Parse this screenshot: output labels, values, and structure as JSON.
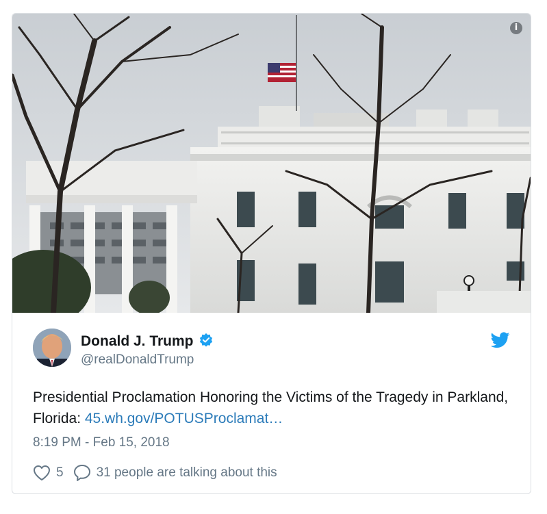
{
  "media": {
    "alt_icon": "info-icon",
    "info_glyph": "i"
  },
  "author": {
    "name": "Donald J. Trump",
    "handle": "@realDonaldTrump",
    "verified_icon": "verified-badge-icon",
    "platform_icon": "twitter-bird-icon"
  },
  "tweet": {
    "text": "Presidential Proclamation Honoring the Victims of the Tragedy in Parkland, Florida: ",
    "link": "45.wh.gov/POTUSProclamat…",
    "timestamp": "8:19 PM - Feb 15, 2018"
  },
  "actions": {
    "like_icon": "heart-icon",
    "like_count": "5",
    "reply_icon": "speech-bubble-icon",
    "talking": "31 people are talking about this"
  },
  "colors": {
    "accent": "#1da1f2",
    "link": "#2b7bb9",
    "text": "#14171a",
    "muted": "#657786",
    "border": "#dcdfe3"
  }
}
